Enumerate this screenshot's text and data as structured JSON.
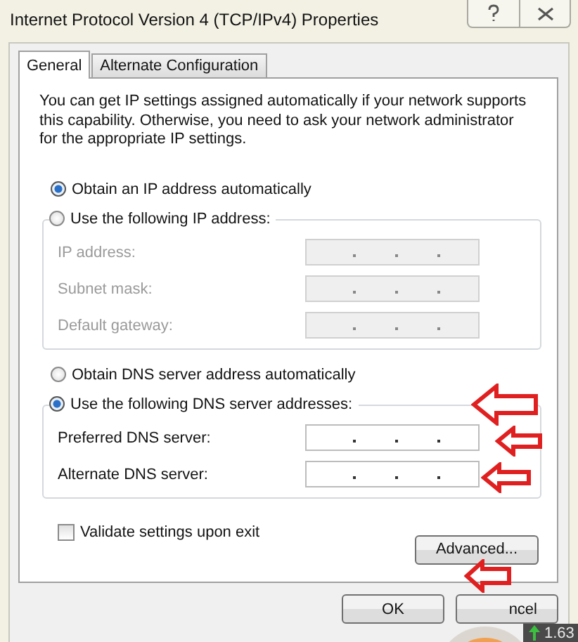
{
  "window": {
    "title": "Internet Protocol Version 4 (TCP/IPv4) Properties"
  },
  "tabs": [
    {
      "label": "General",
      "selected": true
    },
    {
      "label": "Alternate Configuration",
      "selected": false
    }
  ],
  "description": "You can get IP settings assigned automatically if your network supports this capability. Otherwise, you need to ask your network administrator for the appropriate IP settings.",
  "ip_section": {
    "auto_option": {
      "label": "Obtain an IP address automatically",
      "selected": true
    },
    "manual_option": {
      "label": "Use the following IP address:",
      "selected": false
    },
    "fields": [
      {
        "label": "IP address:",
        "disabled": true
      },
      {
        "label": "Subnet mask:",
        "disabled": true
      },
      {
        "label": "Default gateway:",
        "disabled": true
      }
    ]
  },
  "dns_section": {
    "auto_option": {
      "label": "Obtain DNS server address automatically",
      "selected": false
    },
    "manual_option": {
      "label": "Use the following DNS server addresses:",
      "selected": true
    },
    "fields": [
      {
        "label": "Preferred DNS server:",
        "disabled": false
      },
      {
        "label": "Alternate DNS server:",
        "disabled": false
      }
    ]
  },
  "validate": {
    "label": "Validate settings upon exit",
    "checked": false
  },
  "advanced_button": "Advanced...",
  "buttons": [
    "OK",
    "ncel"
  ],
  "overlay_widget": {
    "reading": "1.63"
  }
}
